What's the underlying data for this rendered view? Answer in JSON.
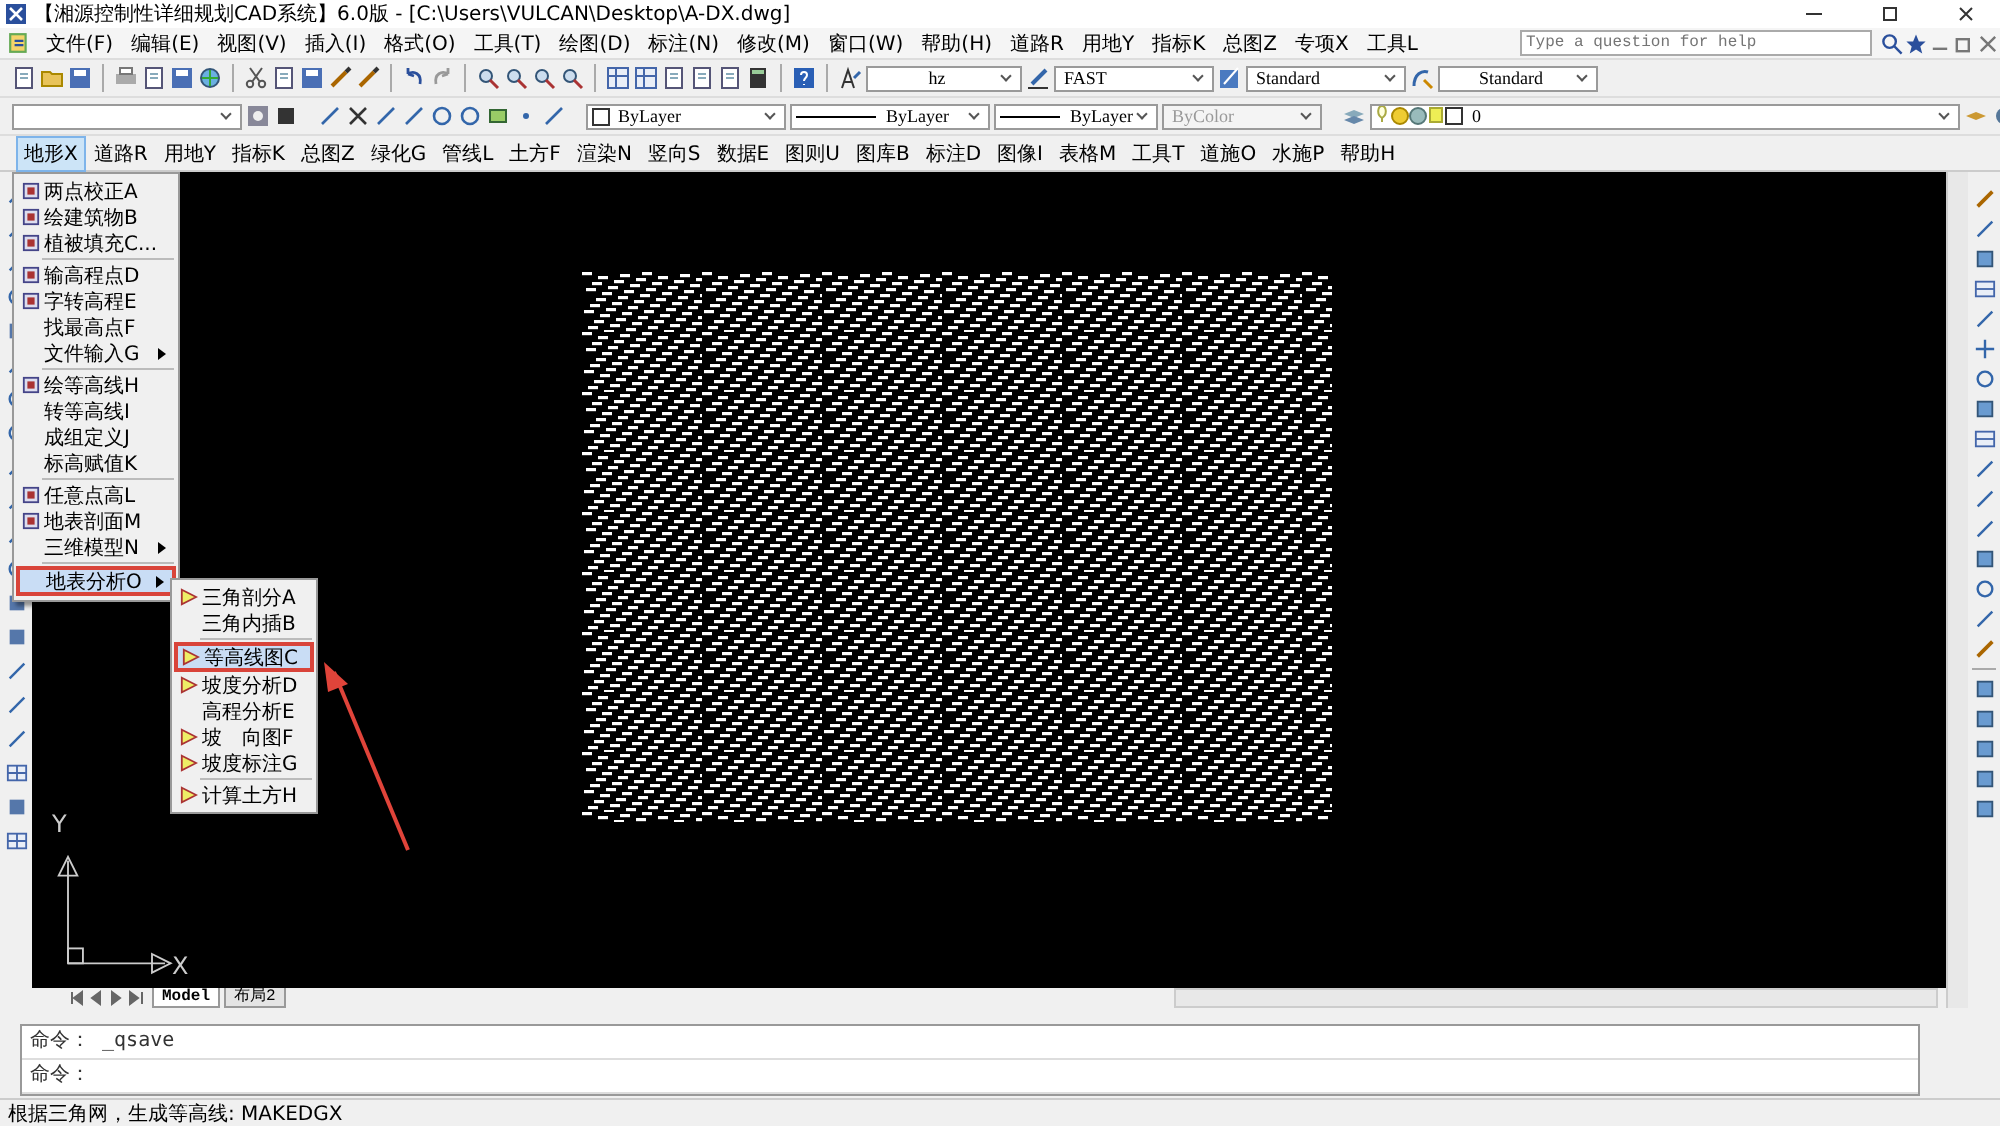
{
  "window": {
    "title": "【湘源控制性详细规划CAD系统】6.0版 - [C:\\Users\\VULCAN\\Desktop\\A-DX.dwg]"
  },
  "menu_bar": [
    "文件(F)",
    "编辑(E)",
    "视图(V)",
    "插入(I)",
    "格式(O)",
    "工具(T)",
    "绘图(D)",
    "标注(N)",
    "修改(M)",
    "窗口(W)",
    "帮助(H)",
    "道路R",
    "用地Y",
    "指标K",
    "总图Z",
    "专项X",
    "工具L"
  ],
  "help_search": {
    "placeholder": "Type a question for help"
  },
  "toolbar": {
    "text_style": "hz",
    "linetype_scale": "FAST",
    "dim_style": "Standard",
    "table_style": "Standard",
    "color_setting": "ByLayer",
    "linetype": "ByLayer",
    "lineweight": "ByLayer",
    "plot_style": {
      "value": "ByColor",
      "disabled": true
    },
    "layer": "0"
  },
  "ribbon_tabs": [
    {
      "label": "地形X",
      "selected": true
    },
    {
      "label": "道路R",
      "selected": false
    },
    {
      "label": "用地Y",
      "selected": false
    },
    {
      "label": "指标K",
      "selected": false
    },
    {
      "label": "总图Z",
      "selected": false
    },
    {
      "label": "绿化G",
      "selected": false
    },
    {
      "label": "管线L",
      "selected": false
    },
    {
      "label": "土方F",
      "selected": false
    },
    {
      "label": "渲染N",
      "selected": false
    },
    {
      "label": "竖向S",
      "selected": false
    },
    {
      "label": "数据E",
      "selected": false
    },
    {
      "label": "图则U",
      "selected": false
    },
    {
      "label": "图库B",
      "selected": false
    },
    {
      "label": "标注D",
      "selected": false
    },
    {
      "label": "图像I",
      "selected": false
    },
    {
      "label": "表格M",
      "selected": false
    },
    {
      "label": "工具T",
      "selected": false
    },
    {
      "label": "道施O",
      "selected": false
    },
    {
      "label": "水施P",
      "selected": false
    },
    {
      "label": "帮助H",
      "selected": false
    }
  ],
  "dropdown_menu": {
    "groups": [
      [
        {
          "label": "两点校正A",
          "kind": "icon",
          "submenu": false,
          "selected": false
        },
        {
          "label": "绘建筑物B",
          "kind": "icon",
          "submenu": false,
          "selected": false
        },
        {
          "label": "植被填充C...",
          "kind": "icon",
          "submenu": false,
          "selected": false
        }
      ],
      [
        {
          "label": "输高程点D",
          "kind": "icon",
          "submenu": false,
          "selected": false
        },
        {
          "label": "字转高程E",
          "kind": "icon",
          "submenu": false,
          "selected": false
        },
        {
          "label": "找最高点F",
          "kind": "plain",
          "submenu": false,
          "selected": false
        },
        {
          "label": "文件输入G",
          "kind": "plain",
          "submenu": true,
          "selected": false
        }
      ],
      [
        {
          "label": "绘等高线H",
          "kind": "icon",
          "submenu": false,
          "selected": false
        },
        {
          "label": "转等高线I",
          "kind": "plain",
          "submenu": false,
          "selected": false
        },
        {
          "label": "成组定义J",
          "kind": "plain",
          "submenu": false,
          "selected": false
        },
        {
          "label": "标高赋值K",
          "kind": "plain",
          "submenu": false,
          "selected": false
        }
      ],
      [
        {
          "label": "任意点高L",
          "kind": "icon",
          "submenu": false,
          "selected": false
        },
        {
          "label": "地表剖面M",
          "kind": "icon",
          "submenu": false,
          "selected": false
        },
        {
          "label": "三维模型N",
          "kind": "plain",
          "submenu": true,
          "selected": false
        }
      ],
      [
        {
          "label": "地表分析O",
          "kind": "plain",
          "submenu": true,
          "selected": true
        }
      ]
    ]
  },
  "submenu": {
    "groups": [
      [
        {
          "label": "三角剖分A",
          "kind": "icon",
          "selected": false
        },
        {
          "label": "三角内插B",
          "kind": "plain",
          "selected": false
        }
      ],
      [
        {
          "label": "等高线图C",
          "kind": "icon",
          "selected": true
        },
        {
          "label": "坡度分析D",
          "kind": "icon",
          "selected": false
        },
        {
          "label": "高程分析E",
          "kind": "plain",
          "selected": false
        },
        {
          "label": "坡　向图F",
          "kind": "icon",
          "selected": false
        },
        {
          "label": "坡度标注G",
          "kind": "icon",
          "selected": false
        }
      ],
      [
        {
          "label": "计算土方H",
          "kind": "icon",
          "selected": false
        }
      ]
    ]
  },
  "ucs": {
    "x_label": "X",
    "y_label": "Y"
  },
  "layout_tabs": [
    {
      "label": "Model",
      "selected": true
    },
    {
      "label": "布局2",
      "selected": false
    }
  ],
  "command_lines": [
    "命令： _qsave",
    "命令："
  ],
  "status_text": "根据三角网，生成等高线: MAKEDGX"
}
